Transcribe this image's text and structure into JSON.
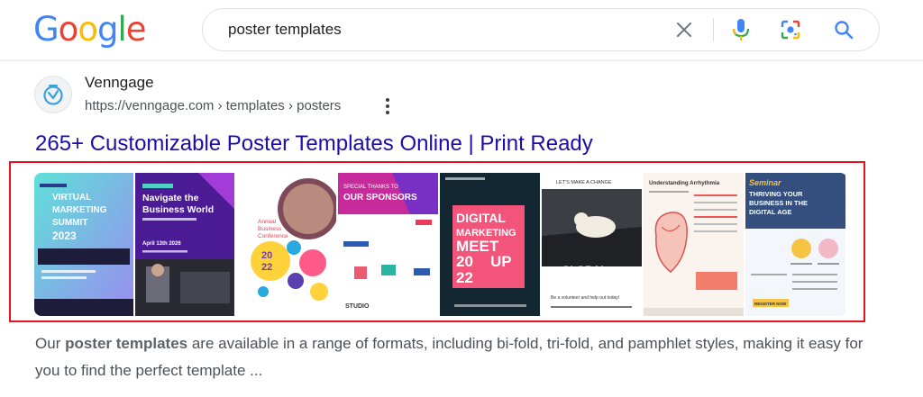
{
  "logo": {
    "letters": [
      "G",
      "o",
      "o",
      "g",
      "l",
      "e"
    ],
    "colors": [
      "#4285f4",
      "#ea4335",
      "#fbbc05",
      "#4285f4",
      "#34a853",
      "#ea4335"
    ]
  },
  "search": {
    "query": "poster templates"
  },
  "result": {
    "site_name": "Venngage",
    "url": "https://venngage.com › templates › posters",
    "title": "265+ Customizable Poster Templates Online | Print Ready",
    "snippet_before": "Our ",
    "snippet_bold": "poster templates",
    "snippet_after": " are available in a range of formats, including bi-fold, tri-fold, and pamphlet styles, making it easy for you to find the perfect template ..."
  },
  "thumbnails": [
    {
      "lines": [
        "VIRTUAL",
        "MARKETING",
        "SUMMIT",
        "2023"
      ]
    },
    {
      "lines": [
        "Navigate the",
        "Business World",
        "April 13th 2026"
      ]
    },
    {
      "lines": [
        "Annual",
        "Business",
        "Conference",
        "20",
        "22"
      ]
    },
    {
      "lines": [
        "SPECIAL THANKS TO",
        "OUR SPONSORS",
        "STUDIO"
      ]
    },
    {
      "lines": [
        "DIGITAL",
        "MARKETING",
        "MEET",
        "20",
        "UP",
        "22"
      ]
    },
    {
      "lines": [
        "LET'S MAKE A CHANGE",
        "GLOBAL",
        "WARMING",
        "Be a volunteer and help out today!"
      ]
    },
    {
      "lines": [
        "Understanding Arrhythmia"
      ]
    },
    {
      "lines": [
        "Seminar",
        "THRIVING YOUR",
        "BUSINESS IN THE",
        "DIGITAL AGE",
        "REGISTER NOW"
      ]
    }
  ]
}
